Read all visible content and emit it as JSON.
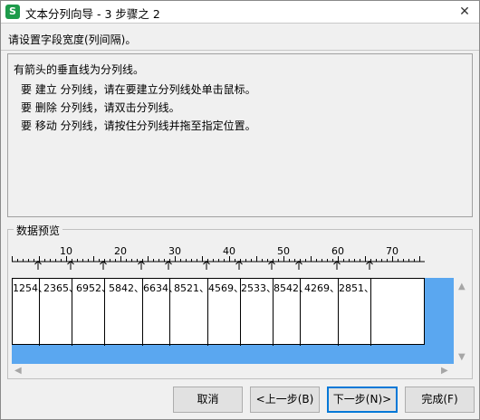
{
  "window": {
    "title": "文本分列向导 - 3 步骤之 2",
    "app_icon": "S",
    "close": "✕"
  },
  "subtitle": "请设置字段宽度(列间隔)。",
  "description": {
    "heading": "有箭头的垂直线为分列线。",
    "lines": [
      "要 建立 分列线，请在要建立分列线处单击鼠标。",
      "要 删除 分列线，请双击分列线。",
      "要 移动 分列线，请按住分列线并拖至指定位置。"
    ]
  },
  "preview": {
    "label": "数据预览",
    "ruler": [
      "10",
      "20",
      "30",
      "40",
      "50",
      "60",
      "70"
    ],
    "cells": [
      "1254、",
      "2365、",
      "6952、",
      "5842、",
      "6634、",
      "8521、",
      "4569、",
      "2533、",
      "8542、",
      "4269、",
      "2851、"
    ]
  },
  "icons": {
    "scroll_up": "▲",
    "scroll_down": "▼",
    "scroll_left": "◀",
    "scroll_right": "▶"
  },
  "buttons": {
    "cancel": "取消",
    "back": "<上一步(B)",
    "next": "下一步(N)>",
    "finish": "完成(F)"
  }
}
